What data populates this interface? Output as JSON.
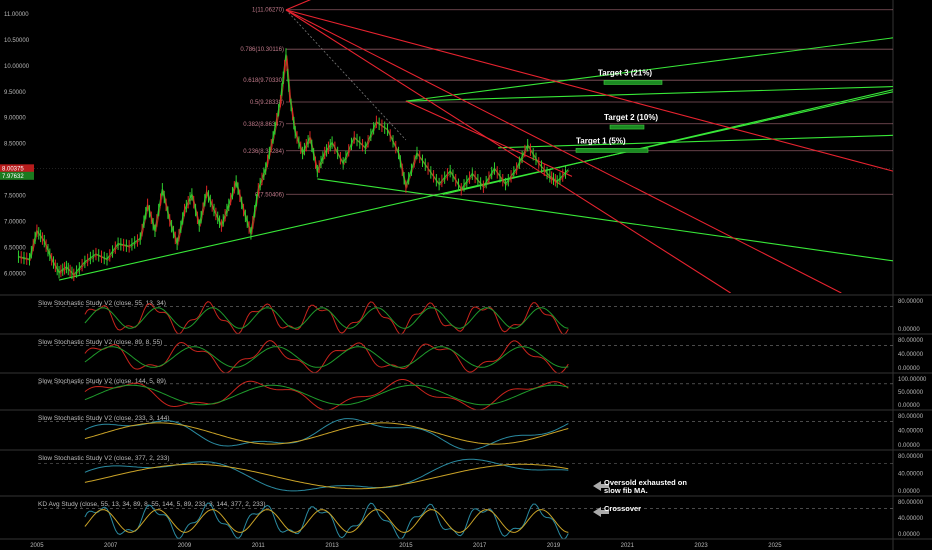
{
  "chart_data": {
    "type": "line",
    "title": "",
    "x_ticks": [
      "2005",
      "2007",
      "2009",
      "2011",
      "2013",
      "2015",
      "2017",
      "2019",
      "2021",
      "2023",
      "2025"
    ],
    "x_range": [
      2004.0,
      2028.2
    ],
    "price_axis": {
      "ticks": [
        "11.00000",
        "10.50000",
        "10.00000",
        "9.50000",
        "9.00000",
        "8.50000",
        "8.00000",
        "7.50000",
        "7.00000",
        "6.50000",
        "6.00000"
      ],
      "ylim": [
        5.6,
        11.25
      ]
    },
    "price_labels": {
      "red": "8.00375",
      "green": "7.97632"
    },
    "fib_levels": [
      {
        "label": "1(11.06270)",
        "value": 11.0627
      },
      {
        "label": "0.786(10.30116)",
        "value": 10.30116
      },
      {
        "label": "0.618(9.70330)",
        "value": 9.7033
      },
      {
        "label": "0.5(9.28338)",
        "value": 9.28338
      },
      {
        "label": "0.382(8.86347)",
        "value": 8.86347
      },
      {
        "label": "0.236(8.34284)",
        "value": 8.34284
      },
      {
        "label": "0(7.50406)",
        "value": 7.50406
      }
    ],
    "targets": [
      {
        "label": "Target 3 (21%)",
        "value": 9.66
      },
      {
        "label": "Target 2 (10%)",
        "value": 8.8
      },
      {
        "label": "Target 1 (5%)",
        "value": 8.35
      }
    ],
    "price_series": [
      [
        2004.5,
        6.3
      ],
      [
        2004.8,
        6.25
      ],
      [
        2005.0,
        6.8
      ],
      [
        2005.2,
        6.6
      ],
      [
        2005.4,
        6.25
      ],
      [
        2005.6,
        6.0
      ],
      [
        2005.8,
        6.1
      ],
      [
        2006.0,
        5.95
      ],
      [
        2006.3,
        6.2
      ],
      [
        2006.6,
        6.35
      ],
      [
        2006.9,
        6.25
      ],
      [
        2007.2,
        6.55
      ],
      [
        2007.5,
        6.5
      ],
      [
        2007.8,
        6.65
      ],
      [
        2008.0,
        7.3
      ],
      [
        2008.2,
        6.8
      ],
      [
        2008.4,
        7.6
      ],
      [
        2008.6,
        7.0
      ],
      [
        2008.8,
        6.55
      ],
      [
        2009.0,
        7.2
      ],
      [
        2009.2,
        7.5
      ],
      [
        2009.4,
        6.9
      ],
      [
        2009.6,
        7.55
      ],
      [
        2009.8,
        7.2
      ],
      [
        2010.0,
        6.9
      ],
      [
        2010.2,
        7.3
      ],
      [
        2010.4,
        7.75
      ],
      [
        2010.6,
        7.2
      ],
      [
        2010.8,
        6.75
      ],
      [
        2011.0,
        7.6
      ],
      [
        2011.2,
        8.0
      ],
      [
        2011.4,
        8.6
      ],
      [
        2011.6,
        9.3
      ],
      [
        2011.75,
        10.2
      ],
      [
        2011.85,
        9.4
      ],
      [
        2012.0,
        8.7
      ],
      [
        2012.2,
        8.3
      ],
      [
        2012.4,
        8.6
      ],
      [
        2012.6,
        7.95
      ],
      [
        2012.8,
        8.3
      ],
      [
        2013.0,
        8.5
      ],
      [
        2013.3,
        8.1
      ],
      [
        2013.6,
        8.6
      ],
      [
        2013.9,
        8.4
      ],
      [
        2014.2,
        8.9
      ],
      [
        2014.5,
        8.75
      ],
      [
        2014.8,
        8.3
      ],
      [
        2015.0,
        7.65
      ],
      [
        2015.3,
        8.3
      ],
      [
        2015.6,
        8.0
      ],
      [
        2015.9,
        7.7
      ],
      [
        2016.2,
        7.95
      ],
      [
        2016.5,
        7.6
      ],
      [
        2016.8,
        7.9
      ],
      [
        2017.1,
        7.65
      ],
      [
        2017.4,
        8.0
      ],
      [
        2017.7,
        7.7
      ],
      [
        2018.0,
        8.0
      ],
      [
        2018.3,
        8.45
      ],
      [
        2018.6,
        8.1
      ],
      [
        2018.9,
        7.85
      ],
      [
        2019.1,
        7.75
      ],
      [
        2019.4,
        7.98
      ]
    ],
    "trend_lines": [
      {
        "color": "green",
        "from": [
          2005.6,
          5.85
        ],
        "to": [
          2028.2,
          9.48
        ]
      },
      {
        "color": "green",
        "from": [
          2015.0,
          9.3
        ],
        "to": [
          2028.2,
          10.52
        ]
      },
      {
        "color": "green",
        "from": [
          2015.0,
          9.3
        ],
        "to": [
          2028.2,
          9.58
        ]
      },
      {
        "color": "green",
        "from": [
          2017.5,
          8.4
        ],
        "to": [
          2028.2,
          8.64
        ]
      },
      {
        "color": "green",
        "from": [
          2012.6,
          7.8
        ],
        "to": [
          2028.2,
          6.22
        ]
      },
      {
        "color": "green",
        "from": [
          2016.0,
          7.5
        ],
        "to": [
          2028.2,
          9.52
        ]
      },
      {
        "color": "red",
        "from": [
          2011.75,
          11.06
        ],
        "to": [
          2028.2,
          7.95
        ]
      },
      {
        "color": "red",
        "from": [
          2011.75,
          11.06
        ],
        "to": [
          2026.8,
          5.6
        ]
      },
      {
        "color": "red",
        "from": [
          2011.75,
          11.06
        ],
        "to": [
          2023.8,
          5.6
        ]
      },
      {
        "color": "red",
        "from": [
          2011.75,
          11.06
        ],
        "to": [
          2013.5,
          11.58
        ]
      },
      {
        "color": "red",
        "from": [
          2015.0,
          9.3
        ],
        "to": [
          2019.5,
          7.85
        ]
      }
    ],
    "oscillators": [
      {
        "label": "Slow Stochastic Study V2 (close, 55, 13, 34)",
        "ticks": [
          "80.00000",
          "0.00000"
        ]
      },
      {
        "label": "Slow Stochastic Study V2 (close, 89, 8, 55)",
        "ticks": [
          "80.00000",
          "40.00000",
          "0.00000"
        ]
      },
      {
        "label": "Slow Stochastic Study V2 (close, 144, 5, 89)",
        "ticks": [
          "100.00000",
          "50.00000",
          "0.00000"
        ]
      },
      {
        "label": "Slow Stochastic Study V2 (close, 233, 3, 144)",
        "ticks": [
          "80.00000",
          "40.00000",
          "0.00000"
        ]
      },
      {
        "label": "Slow Stochastic Study V2 (close, 377, 2, 233)",
        "ticks": [
          "80.00000",
          "40.00000",
          "0.00000"
        ]
      },
      {
        "label": "KD Avg Study (close, 55, 13, 34, 89, 8, 55, 144, 5, 89, 233, 3, 144, 377, 2, 233)",
        "ticks": [
          "80.00000",
          "40.00000",
          "0.00000"
        ]
      }
    ],
    "annotations": [
      {
        "pane": 4,
        "text": "Oversold exhausted on\nslow fib MA."
      },
      {
        "pane": 5,
        "text": "Crossover"
      }
    ],
    "colors": {
      "up": "#2fd12f",
      "down": "#e02424",
      "fib": "#c07a8a",
      "trend_green": "#38e838",
      "trend_red": "#e8232f",
      "osc_k_red": "#c8241c",
      "osc_d_green": "#1f9a2c",
      "osc_teal": "#2a8aa0",
      "osc_yellow": "#c9a227"
    }
  }
}
